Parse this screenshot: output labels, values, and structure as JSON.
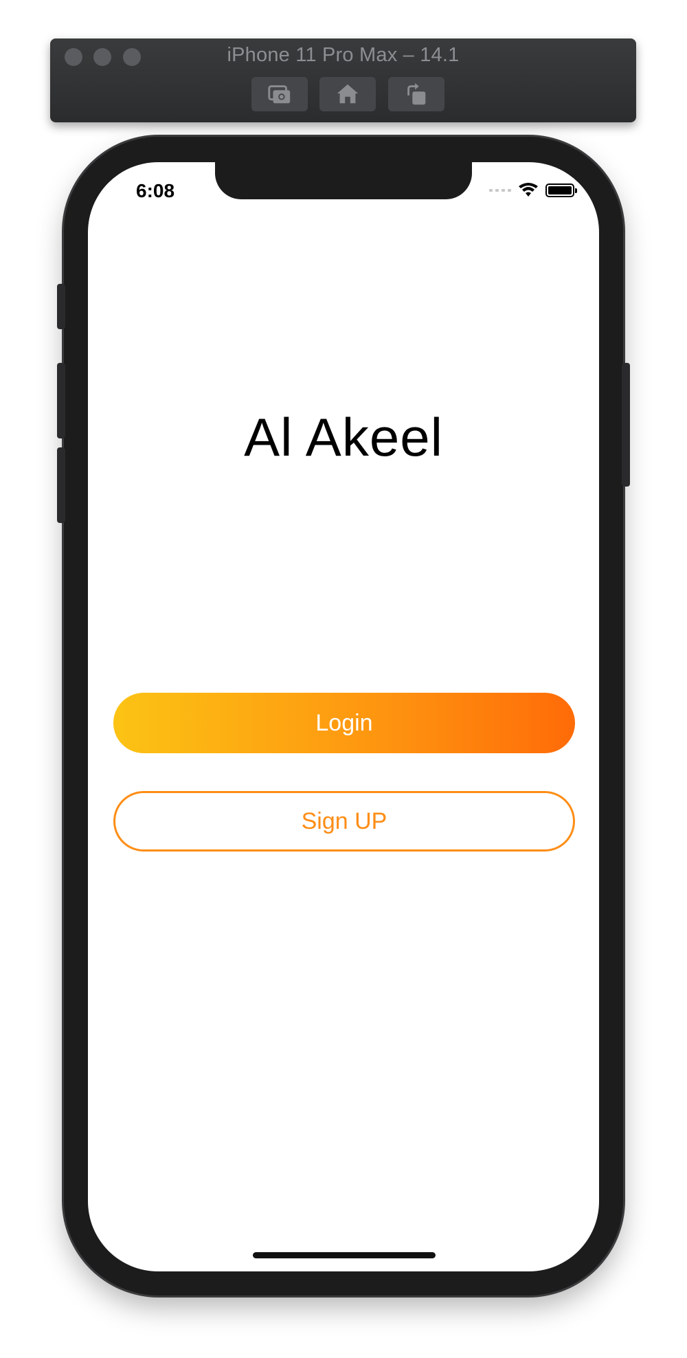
{
  "simulator": {
    "title": "iPhone 11 Pro Max – 14.1",
    "buttons": [
      "screenshot-icon",
      "home-icon",
      "rotate-icon"
    ]
  },
  "status_bar": {
    "time": "6:08",
    "icons": [
      "signal-icon",
      "wifi-icon",
      "battery-icon"
    ]
  },
  "app": {
    "title": "Al Akeel",
    "login_label": "Login",
    "signup_label": "Sign UP"
  },
  "colors": {
    "accent_start": "#fcc314",
    "accent_end": "#ff6b08",
    "outline": "#fe8d15"
  }
}
